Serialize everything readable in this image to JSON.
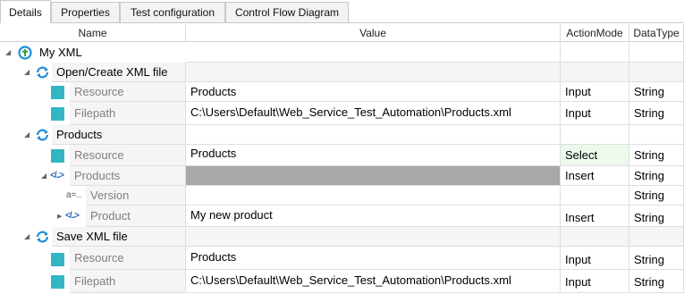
{
  "tabs": [
    {
      "label": "Details"
    },
    {
      "label": "Properties"
    },
    {
      "label": "Test configuration"
    },
    {
      "label": "Control Flow Diagram"
    }
  ],
  "columns": {
    "name": "Name",
    "value": "Value",
    "action_mode": "ActionMode",
    "data_type": "DataType"
  },
  "rows": [
    {
      "name": "My XML",
      "value": "",
      "action": "",
      "type": ""
    },
    {
      "name": "Open/Create XML file",
      "value": "",
      "action": "",
      "type": ""
    },
    {
      "name": "Resource",
      "value": "Products",
      "action": "Input",
      "type": "String"
    },
    {
      "name": "Filepath",
      "value": "C:\\Users\\Default\\Web_Service_Test_Automation\\Products.xml",
      "action": "Input",
      "type": "String"
    },
    {
      "name": "Products",
      "value": "",
      "action": "",
      "type": ""
    },
    {
      "name": "Resource",
      "value": "Products",
      "action": "Select",
      "type": "String"
    },
    {
      "name": "Products",
      "value": "",
      "action": "Insert",
      "type": "String"
    },
    {
      "name": "Version",
      "value": "",
      "action": "",
      "type": "String"
    },
    {
      "name": "Product",
      "value": "My new product",
      "action": "Insert",
      "type": "String"
    },
    {
      "name": "Save XML file",
      "value": "",
      "action": "",
      "type": ""
    },
    {
      "name": "Resource",
      "value": "Products",
      "action": "Input",
      "type": "String"
    },
    {
      "name": "Filepath",
      "value": "C:\\Users\\Default\\Web_Service_Test_Automation\\Products.xml",
      "action": "Input",
      "type": "String"
    }
  ],
  "colors": {
    "accent_teal": "#33b6c3",
    "module_blue": "#1e8fd8",
    "selected_green": "#ecf9ec",
    "disabled_gray": "#a8a8a8"
  },
  "icons": {
    "root": "testcase-icon",
    "module": "refresh-icon",
    "attribute": "teal-square-icon",
    "xml_node": "xml-tag-icon",
    "xml_attribute": "xml-attribute-icon"
  }
}
